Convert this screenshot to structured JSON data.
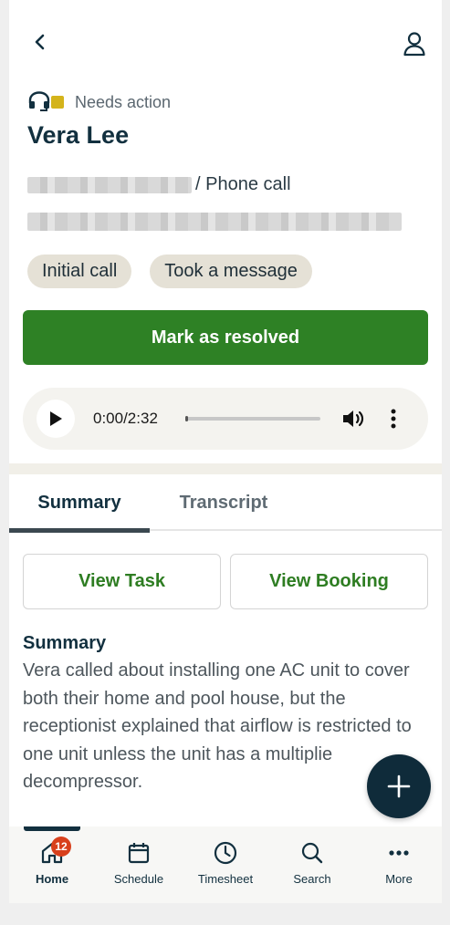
{
  "header": {
    "back_icon": "chevron-left-icon",
    "profile_icon": "person-icon"
  },
  "call": {
    "channel_icon": "headset-icon",
    "status_text": "Needs action",
    "status_color": "#d4b41b",
    "caller_name": "Vera Lee",
    "type_suffix": "/ Phone call",
    "chips": [
      "Initial call",
      "Took a message"
    ]
  },
  "actions": {
    "resolve_label": "Mark as resolved",
    "accent_color": "#2e8125"
  },
  "player": {
    "time": "0:00/2:32",
    "progress_fraction": 0.0
  },
  "tabs": {
    "summary": "Summary",
    "transcript": "Transcript",
    "active": "Summary"
  },
  "links": {
    "view_task": "View Task",
    "view_booking": "View Booking"
  },
  "summary": {
    "heading": "Summary",
    "body": "Vera called about installing one AC unit to cover both their home and pool house, but the receptionist explained that airflow is restricted to one unit unless the unit has a multiplie decompressor."
  },
  "nav": {
    "items": [
      {
        "label": "Home",
        "icon": "home-icon",
        "badge": "12",
        "active": true
      },
      {
        "label": "Schedule",
        "icon": "calendar-icon"
      },
      {
        "label": "Timesheet",
        "icon": "clock-icon"
      },
      {
        "label": "Search",
        "icon": "search-icon"
      },
      {
        "label": "More",
        "icon": "more-icon"
      }
    ]
  }
}
